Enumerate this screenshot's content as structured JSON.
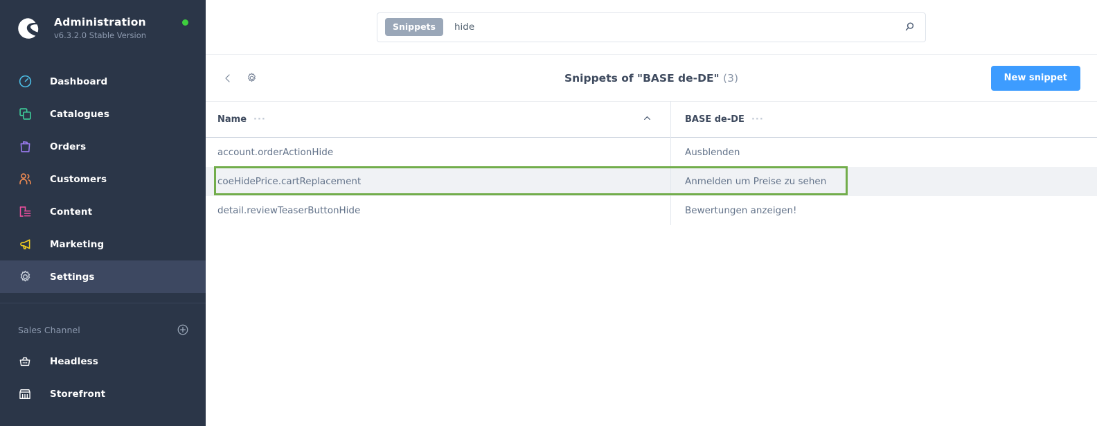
{
  "sidebar": {
    "brand": {
      "title": "Administration",
      "version": "v6.3.2.0 Stable Version",
      "logo_icon": "shopware-logo-icon",
      "status_dot_color": "#3ecf3e"
    },
    "items": [
      {
        "label": "Dashboard",
        "icon": "speedometer-icon",
        "color": "#4dc0e8",
        "active": false
      },
      {
        "label": "Catalogues",
        "icon": "layers-icon",
        "color": "#3ecf9a",
        "active": false
      },
      {
        "label": "Orders",
        "icon": "bag-icon",
        "color": "#9b7bf0",
        "active": false
      },
      {
        "label": "Customers",
        "icon": "users-icon",
        "color": "#f08b52",
        "active": false
      },
      {
        "label": "Content",
        "icon": "document-icon",
        "color": "#ed4f9e",
        "active": false
      },
      {
        "label": "Marketing",
        "icon": "megaphone-icon",
        "color": "#f5d020",
        "active": false
      },
      {
        "label": "Settings",
        "icon": "gear-icon",
        "color": "#c6cdd8",
        "active": true
      }
    ],
    "sales_channel": {
      "title": "Sales Channel",
      "add_icon": "plus-circle-icon",
      "items": [
        {
          "label": "Headless",
          "icon": "basket-icon"
        },
        {
          "label": "Storefront",
          "icon": "store-icon"
        }
      ]
    }
  },
  "search": {
    "pill_label": "Snippets",
    "value": "hide",
    "placeholder": "Search...",
    "icon": "search-icon"
  },
  "page_header": {
    "back_icon": "chevron-left-icon",
    "settings_icon": "gear-icon",
    "title": "Snippets of \"BASE de-DE\"",
    "count": "(3)",
    "new_button_label": "New snippet",
    "new_button_color": "#3d9cff"
  },
  "table": {
    "columns": [
      {
        "label": "Name",
        "dots": "···",
        "sorted": "asc",
        "sort_icon": "chevron-up-icon"
      },
      {
        "label": "BASE de-DE",
        "dots": "···",
        "sorted": "none"
      }
    ],
    "rows": [
      {
        "name": "account.orderActionHide",
        "value": "Ausblenden",
        "selected": false
      },
      {
        "name": "coeHidePrice.cartReplacement",
        "value": "Anmelden um Preise zu sehen",
        "selected": true
      },
      {
        "name": "detail.reviewTeaserButtonHide",
        "value": "Bewertungen anzeigen!",
        "selected": false
      }
    ],
    "highlight_color": "#72ad4b"
  }
}
